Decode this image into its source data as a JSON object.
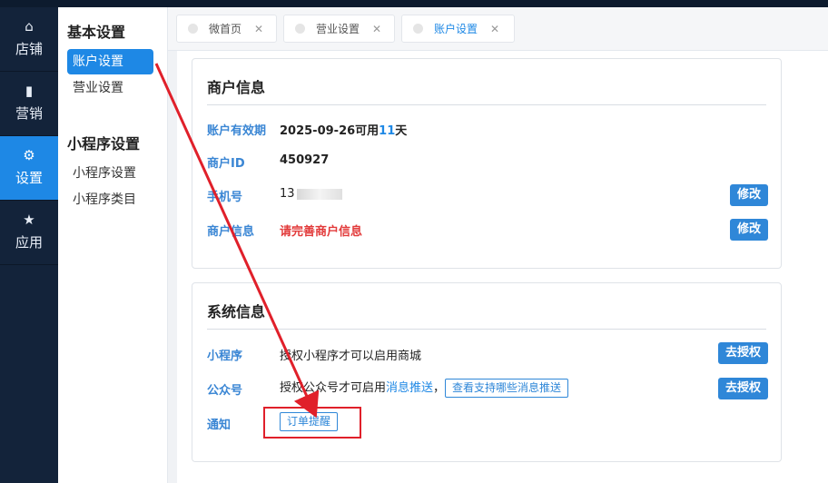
{
  "leftnav": {
    "items": [
      {
        "icon": "store-icon",
        "glyph": "⌂",
        "label": "店铺"
      },
      {
        "icon": "chart-icon",
        "glyph": "▮",
        "label": "营销"
      },
      {
        "icon": "gear-icon",
        "glyph": "⚙",
        "label": "设置"
      },
      {
        "icon": "star-icon",
        "glyph": "★",
        "label": "应用"
      }
    ]
  },
  "subnav": {
    "group1": "基本设置",
    "account": "账户设置",
    "business": "营业设置",
    "group2": "小程序设置",
    "mp_settings": "小程序设置",
    "mp_category": "小程序类目"
  },
  "tabs": [
    {
      "label": "微首页"
    },
    {
      "label": "营业设置"
    },
    {
      "label": "账户设置"
    }
  ],
  "merchant": {
    "title": "商户信息",
    "validity_label": "账户有效期",
    "validity_prefix": "2025-09-26可用",
    "validity_days": "11",
    "validity_suffix": "天",
    "id_label": "商户ID",
    "id_value": "450927",
    "phone_label": "手机号",
    "phone_value": "13",
    "info_label": "商户信息",
    "info_value": "请完善商户信息",
    "edit_label": "修改"
  },
  "system": {
    "title": "系统信息",
    "mp_label": "小程序",
    "mp_text": "授权小程序才可以启用商城",
    "oa_label": "公众号",
    "oa_text": "授权公众号才可启用",
    "oa_link": "消息推送",
    "oa_comma": "，",
    "oa_button": "查看支持哪些消息推送",
    "authorize_label": "去授权",
    "notify_label": "通知",
    "notify_button": "订单提醒"
  },
  "colors": {
    "accent": "#1e88e5",
    "nav_bg": "#13233a",
    "warning": "#e23a3a",
    "annotation": "#e0202a"
  }
}
